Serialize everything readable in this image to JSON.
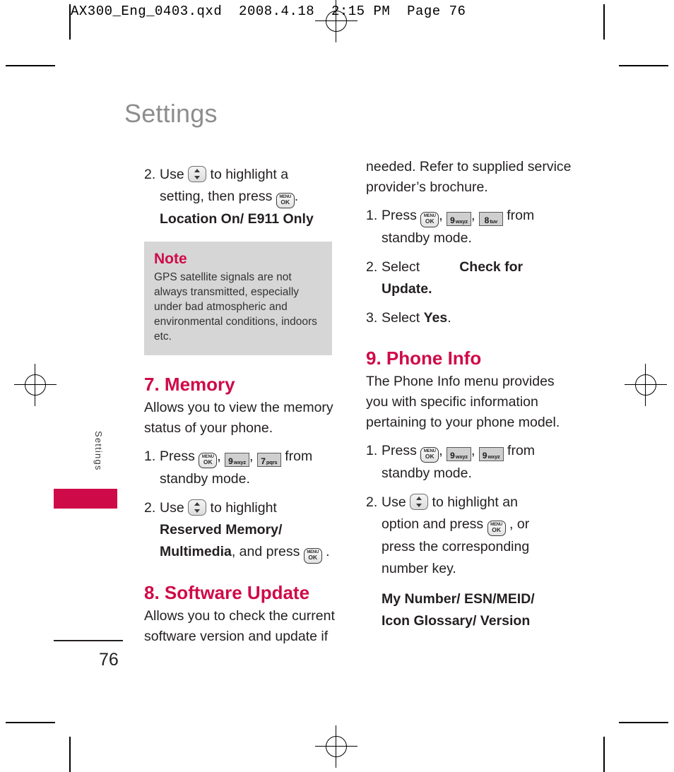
{
  "print_marks": {
    "slug": "AX300_Eng_0403.qxd  2008.4.18  2:15 PM  Page 76"
  },
  "page": {
    "title": "Settings",
    "side_tab_label": "Settings",
    "page_number": "76",
    "accent_color": "#cf0a48",
    "title_color": "#8d8d8d",
    "note_bg_color": "#d6d6d6"
  },
  "keys": {
    "menu_ok": {
      "line1": "MENU",
      "line2": "OK",
      "name": "menu-ok-key"
    },
    "nav": {
      "name": "navigation-updown-key"
    },
    "num9": {
      "digit": "9",
      "letters": "wxyz"
    },
    "num8": {
      "digit": "8",
      "letters": "tuv"
    },
    "num7": {
      "digit": "7",
      "letters": "pqrs"
    }
  },
  "left_column": {
    "step2": {
      "num": "2.",
      "before_key": "Use",
      "after_key": "to highlight a",
      "line2_before": "setting, then press",
      "line2_after": ".",
      "options": "Location On/ E911 Only"
    },
    "note": {
      "title": "Note",
      "text": "GPS satellite signals are not always transmitted, especially under bad atmospheric and environmental conditions, indoors etc."
    },
    "memory": {
      "heading": "7. Memory",
      "intro": "Allows you to view the memory status of your phone.",
      "step1": {
        "num": "1.",
        "before": "Press",
        "after": "from",
        "line2": "standby mode."
      },
      "step2": {
        "num": "2.",
        "before_key": "Use",
        "after_key": "to highlight",
        "option_line1": "Reserved Memory/",
        "option_line2": "Multimedia",
        "mid": ", and press",
        "end": "."
      }
    },
    "software_update": {
      "heading": "8. Software Update",
      "intro": "Allows you to check the current software version and update if"
    }
  },
  "right_column": {
    "intro_continued": "needed. Refer to supplied service provider’s brochure.",
    "sw_step1": {
      "num": "1.",
      "before": "Press",
      "after": "from",
      "line2": "standby mode."
    },
    "sw_step2": {
      "num": "2.",
      "label": "Select",
      "option_line1": "Check for",
      "option_line2": "Update."
    },
    "sw_step3": {
      "num": "3.",
      "label": "Select",
      "option": "Yes",
      "end": "."
    },
    "phone_info": {
      "heading": "9. Phone Info",
      "intro": "The Phone Info menu provides you with specific information pertaining to your phone model.",
      "step1": {
        "num": "1.",
        "before": "Press",
        "after": "from",
        "line2": "standby mode."
      },
      "step2": {
        "num": "2.",
        "before_key": "Use",
        "after_key": "to highlight an",
        "line2_before": "option and press",
        "line2_after": ", or",
        "line3": "press the corresponding",
        "line4": "number key."
      },
      "options_line1": "My Number/ ESN/MEID/",
      "options_line2": "Icon Glossary/ Version"
    }
  }
}
